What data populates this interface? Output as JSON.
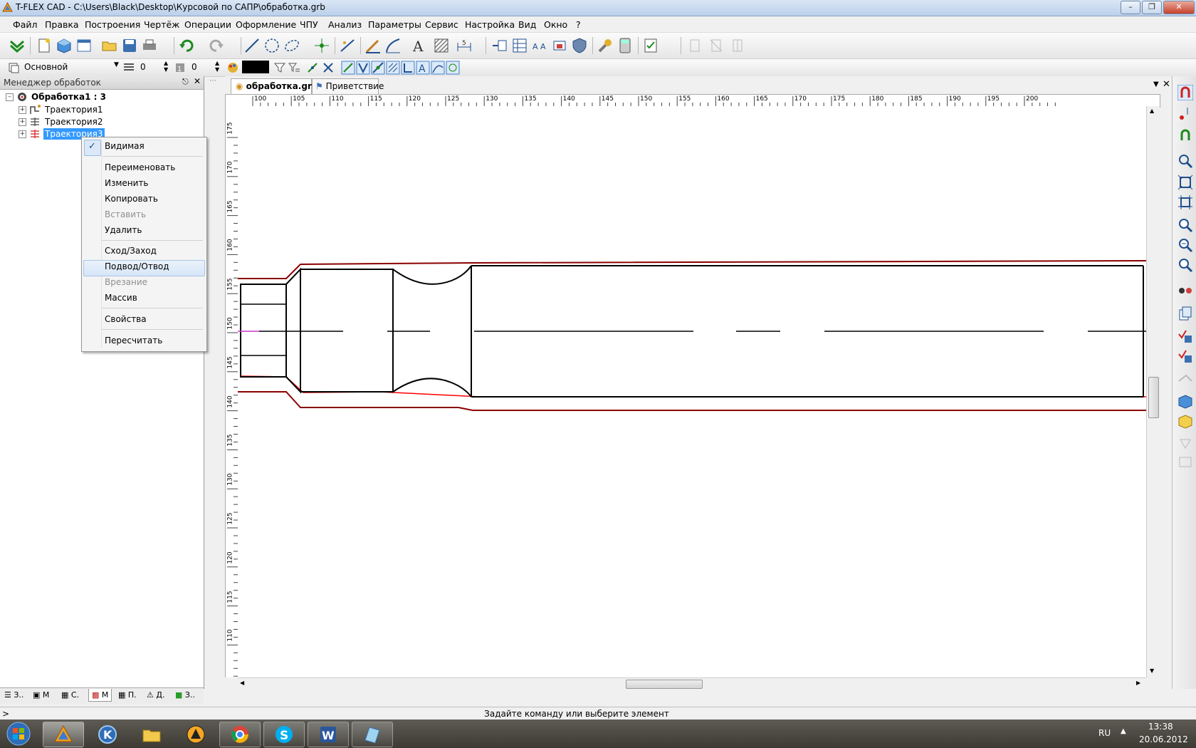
{
  "window": {
    "title": "T-FLEX CAD - C:\\Users\\Black\\Desktop\\Курсовой по САПР\\обработка.grb"
  },
  "menu": [
    "Файл",
    "Правка",
    "Построения",
    "Чертёж",
    "Операции",
    "Оформление",
    "ЧПУ",
    "Анализ",
    "Параметры",
    "Сервис",
    "Настройка",
    "Вид",
    "Окно",
    "?"
  ],
  "props_bar": {
    "layer": "Основной",
    "width": "0",
    "level": "0"
  },
  "left_panel": {
    "title": "Менеджер обработок",
    "root": "Обработка1 : 3",
    "items": [
      "Траектория1",
      "Траектория2",
      "Траектория3"
    ],
    "tabs": [
      "З..",
      "М",
      "С.",
      "М",
      "П.",
      "Д.",
      "З.."
    ]
  },
  "context_menu": {
    "items": [
      "Видимая",
      "Переименовать",
      "Изменить",
      "Копировать",
      "Вставить",
      "Удалить",
      "Сход/Заход",
      "Подвод/Отвод",
      "Врезание",
      "Массив",
      "Свойства",
      "Пересчитать"
    ],
    "checked": "Видимая",
    "disabled": [
      "Вставить",
      "Врезание"
    ],
    "highlighted": "Подвод/Отвод"
  },
  "doc_tabs": [
    "обработка.grb",
    "Приветствие"
  ],
  "ruler_h": [
    "100",
    "105",
    "110",
    "115",
    "120",
    "125",
    "130",
    "135",
    "140",
    "145",
    "150",
    "155",
    "160",
    "165",
    "170",
    "175",
    "180",
    "185",
    "190",
    "195",
    "200"
  ],
  "ruler_v": [
    "175",
    "170",
    "165",
    "160",
    "155",
    "150",
    "145",
    "140",
    "135",
    "130",
    "125",
    "120",
    "115",
    "110"
  ],
  "status": {
    "prompt": "Задайте команду или выберите элемент",
    "cmd": ">"
  },
  "taskbar": {
    "lang": "RU",
    "time": "13:38",
    "date": "20.06.2012"
  },
  "colors": {
    "drawing": "#000000",
    "path_dark": "#8b0000",
    "path_red": "#ff0000",
    "accent": "#3399ff"
  }
}
